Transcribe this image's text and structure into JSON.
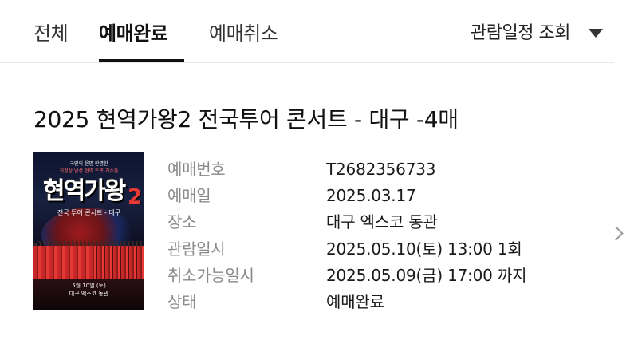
{
  "tabs": [
    {
      "label": "전체"
    },
    {
      "label": "예매완료",
      "active": true
    },
    {
      "label": "예매취소"
    }
  ],
  "schedule_view": {
    "label": "관람일정 조회",
    "icon": "caret-down-icon"
  },
  "booking": {
    "title": "2025 현역가왕2 전국투어 콘서트 - 대구 -4매",
    "poster": {
      "logo": "현역가왕",
      "logo_number": "2",
      "subtitle": "전국 투어 콘서트 - 대구",
      "tagline_1": "국민의 운명 한명한",
      "tagline_2": "최정상 남성 현역 트롯 가수들",
      "date": "5월 10일 (토)",
      "venue": "대구 엑스코 동관"
    },
    "details": [
      {
        "label": "예매번호",
        "value": "T2682356733"
      },
      {
        "label": "예매일",
        "value": "2025.03.17"
      },
      {
        "label": "장소",
        "value": "대구 엑스코 동관"
      },
      {
        "label": "관람일시",
        "value": "2025.05.10(토) 13:00 1회"
      },
      {
        "label": "취소가능일시",
        "value": "2025.05.09(금) 17:00 까지"
      },
      {
        "label": "상태",
        "value": "예매완료"
      }
    ]
  },
  "colors": {
    "accent": "#111111",
    "label_gray": "#8a8a8a",
    "divider": "#e6e6e6"
  }
}
